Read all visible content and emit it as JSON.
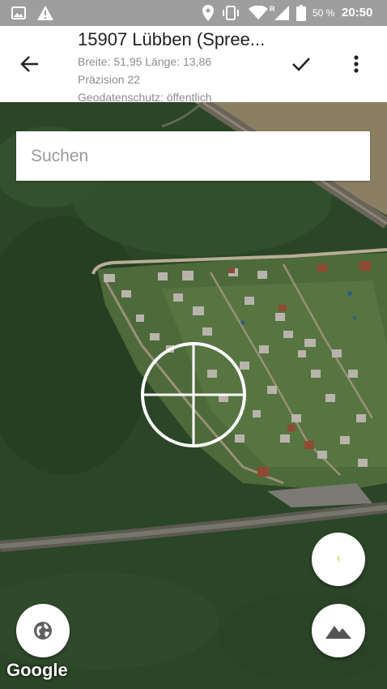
{
  "status_bar": {
    "icons": [
      "gallery-icon",
      "warning-icon",
      "location-icon",
      "vibrate-icon",
      "wifi-icon",
      "signal-icon",
      "battery-icon"
    ],
    "roaming_label": "R",
    "battery_percent": "50 %",
    "time": "20:50"
  },
  "toolbar": {
    "title": "15907 Lübben (Spree...",
    "latlng": "Breite: 51,95  Länge: 13,86",
    "precision": "Präzision 22",
    "geo_privacy": "Geodatenschutz: öffentlich",
    "icons": {
      "back": "arrow-back-icon",
      "confirm": "check-icon",
      "more": "more-vert-icon"
    }
  },
  "map": {
    "search_placeholder": "Suchen",
    "search_value": "",
    "attribution": "Google",
    "crosshair": "crosshair-icon",
    "fabs": {
      "compass": "compass-icon",
      "globe": "globe-icon",
      "terrain": "terrain-icon"
    },
    "colors": {
      "forest": "#2b4527",
      "gardens": "#4d6a3a",
      "road": "#6a6a60",
      "field": "#8a7f63"
    }
  }
}
